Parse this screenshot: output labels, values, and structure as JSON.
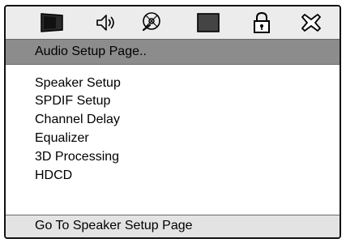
{
  "tab_icons": [
    {
      "icon": "tv-screen-icon"
    },
    {
      "icon": "speaker-icon"
    },
    {
      "icon": "disc-icon"
    },
    {
      "icon": "square-icon"
    },
    {
      "icon": "padlock-icon"
    },
    {
      "icon": "cross-icon"
    }
  ],
  "page_title": "Audio Setup Page..",
  "menu": {
    "items": [
      {
        "label": "Speaker Setup"
      },
      {
        "label": "SPDIF Setup"
      },
      {
        "label": "Channel Delay"
      },
      {
        "label": "Equalizer"
      },
      {
        "label": "3D Processing"
      },
      {
        "label": "HDCD"
      }
    ]
  },
  "status_text": "Go To Speaker Setup Page",
  "colors": {
    "header_bar": "#8c8c8c",
    "menu_background": "#ffffff",
    "panel_background": "#ececec",
    "frame": "#111111"
  }
}
